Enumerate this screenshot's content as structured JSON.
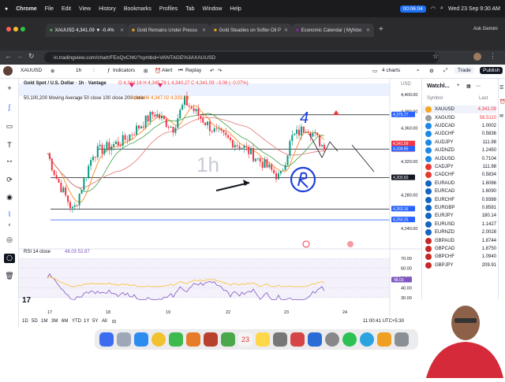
{
  "menubar": {
    "app": "Chrome",
    "items": [
      "File",
      "Edit",
      "View",
      "History",
      "Bookmarks",
      "Profiles",
      "Tab",
      "Window",
      "Help"
    ],
    "recorder": "00:06:04",
    "datetime": "Wed 23 Sep  9:30 AM"
  },
  "tabs": [
    {
      "label": "XAUUSD 4,341.09 ▼ -0.4%"
    },
    {
      "label": "Gold Remains Under Pressu"
    },
    {
      "label": "Gold Steadies on Softer Oil P"
    },
    {
      "label": "Economic Calendar | Myfxbo"
    }
  ],
  "tab_right": "Ask Gemini",
  "address": {
    "url": "in.tradingview.com/chart/FEoQvChK/?symbol=VANTAGE%3AXAUUSD"
  },
  "toolbar": {
    "symbol": "XAUUSD",
    "interval": "1h",
    "indicators": "Indicators",
    "alert": "Alert",
    "replay": "Replay",
    "layout": "4 charts",
    "trade": "Trade",
    "publish": "Publish"
  },
  "chart": {
    "title": "Gold Spot / U.S. Dollar · 1h · Vantage",
    "ohlc": "O 4,344.16 H 4,345.78 L 4,340.27 C 4,341.09 −3.08 (−0.07%)",
    "ma_label": "50,100,200 Moving Average 50 close 100 close 200 close",
    "ma_values": "4,343.06   4,347.02   4,333.13",
    "watermark": "1h",
    "annotation_text": "4",
    "yaxis_currency": "USD",
    "price_ticks": [
      "4,400.00",
      "4,380.00",
      "4,360.00",
      "4,320.00",
      "4,280.00",
      "4,240.00"
    ],
    "price_tags": [
      {
        "value": "4,375.77",
        "color": "#2962ff"
      },
      {
        "value": "4,341.09",
        "color": "#f23645"
      },
      {
        "value": "29:18",
        "color": "#f23645"
      },
      {
        "value": "4,334.85",
        "color": "#2962ff"
      },
      {
        "value": "4,300.60",
        "color": "#131722"
      },
      {
        "value": "4,263.16",
        "color": "#2962ff"
      },
      {
        "value": "4,250.25",
        "color": "#2962ff"
      }
    ],
    "date_ticks": [
      "17",
      "18",
      "19",
      "22",
      "23",
      "24"
    ],
    "rsi_label": "RSI 14 close",
    "rsi_values": "48.03   52.87",
    "rsi_ticks": [
      "70.00",
      "60.00",
      "50.00",
      "40.00",
      "30.00"
    ],
    "rsi_current": "48.03"
  },
  "timeframes": [
    "1D",
    "5D",
    "1M",
    "3M",
    "6M",
    "YTD",
    "1Y",
    "5Y",
    "All"
  ],
  "clock": "11:00:41 UTC+5:30",
  "watchlist": {
    "title": "Watchl...",
    "col_symbol": "Symbol",
    "col_last": "Last",
    "rows": [
      {
        "symbol": "XAUUSD",
        "last": "4,341.09",
        "color": "#f5a623"
      },
      {
        "symbol": "XAGUSD",
        "last": "56.5110",
        "color": "#9e9e9e"
      },
      {
        "symbol": "AUDCAD",
        "last": "1.0002",
        "color": "#1e88e5"
      },
      {
        "symbol": "AUDCHF",
        "last": "0.5836",
        "color": "#1e88e5"
      },
      {
        "symbol": "AUDJPY",
        "last": "111.98",
        "color": "#1e88e5"
      },
      {
        "symbol": "AUDNZD",
        "last": "1.2450",
        "color": "#1e88e5"
      },
      {
        "symbol": "AUDUSD",
        "last": "0.7104",
        "color": "#1e88e5"
      },
      {
        "symbol": "CADJPY",
        "last": "111.98",
        "color": "#e53935"
      },
      {
        "symbol": "CADCHF",
        "last": "0.5834",
        "color": "#e53935"
      },
      {
        "symbol": "EURAUD",
        "last": "1.6086",
        "color": "#1565c0"
      },
      {
        "symbol": "EURCAD",
        "last": "1.6090",
        "color": "#1565c0"
      },
      {
        "symbol": "EURCHF",
        "last": "0.9388",
        "color": "#1565c0"
      },
      {
        "symbol": "EURGBP",
        "last": "0.8581",
        "color": "#1565c0"
      },
      {
        "symbol": "EURJPY",
        "last": "180.14",
        "color": "#1565c0"
      },
      {
        "symbol": "EURUSD",
        "last": "1.1427",
        "color": "#1565c0"
      },
      {
        "symbol": "EURNZD",
        "last": "2.0028",
        "color": "#1565c0"
      },
      {
        "symbol": "GBPAUD",
        "last": "1.8744",
        "color": "#c62828"
      },
      {
        "symbol": "GBPCAD",
        "last": "1.8750",
        "color": "#c62828"
      },
      {
        "symbol": "GBPCHF",
        "last": "1.0940",
        "color": "#c62828"
      },
      {
        "symbol": "GBPJPY",
        "last": "209.91",
        "color": "#c62828"
      }
    ]
  }
}
